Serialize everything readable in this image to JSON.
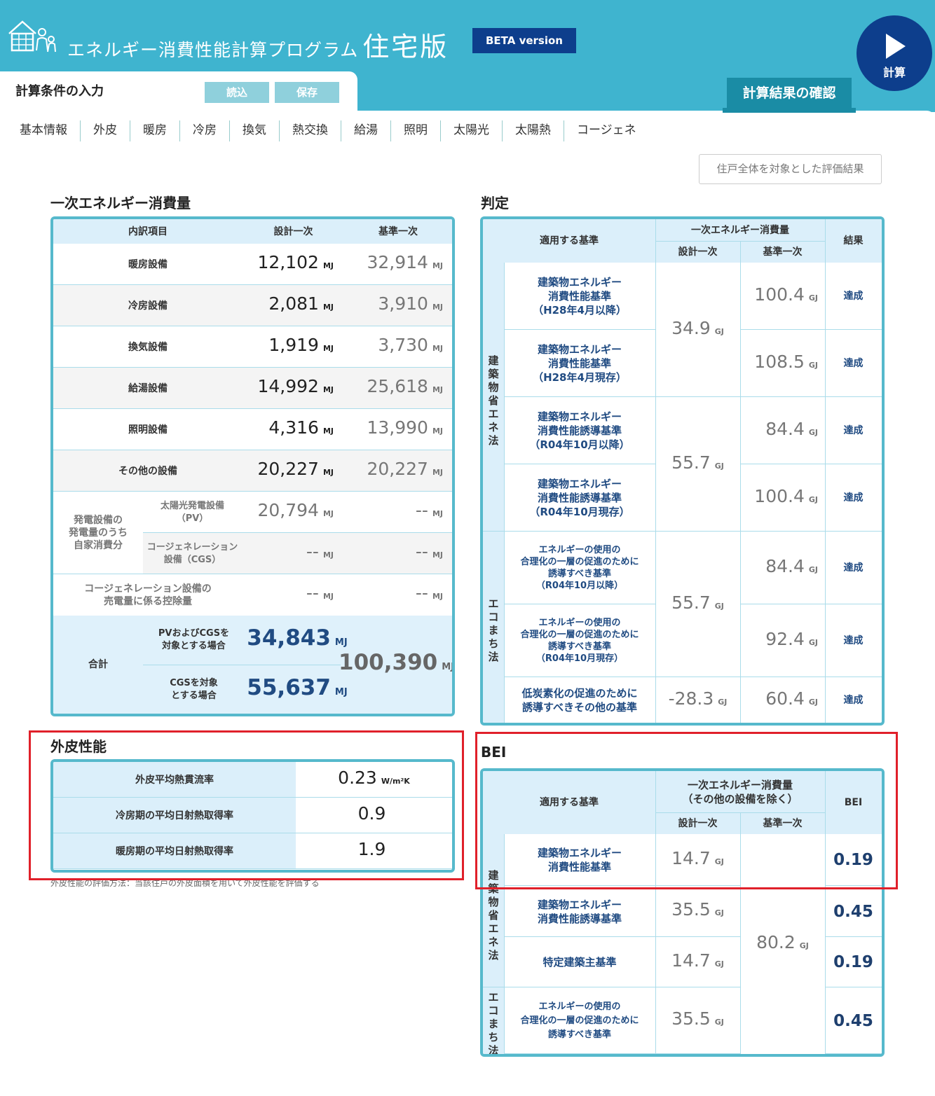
{
  "header": {
    "title": "エネルギー消費性能計算プログラム",
    "title_big": "住宅版",
    "beta": "BETA version",
    "calc_button": "計算"
  },
  "input_tab": {
    "label": "計算条件の入力",
    "load": "読込",
    "save": "保存"
  },
  "result_tab": "計算結果の確認",
  "nav": [
    "基本情報",
    "外皮",
    "暖房",
    "冷房",
    "換気",
    "熱交換",
    "給湯",
    "照明",
    "太陽光",
    "太陽熱",
    "コージェネ"
  ],
  "scope_button": "住戸全体を対象とした評価結果",
  "primary": {
    "title": "一次エネルギー消費量",
    "headers": [
      "内訳項目",
      "設計一次",
      "基準一次"
    ],
    "unit": "MJ",
    "rows": [
      {
        "label": "暖房設備",
        "design": "12,102",
        "base": "32,914"
      },
      {
        "label": "冷房設備",
        "design": "2,081",
        "base": "3,910"
      },
      {
        "label": "換気設備",
        "design": "1,919",
        "base": "3,730"
      },
      {
        "label": "給湯設備",
        "design": "14,992",
        "base": "25,618"
      },
      {
        "label": "照明設備",
        "design": "4,316",
        "base": "13,990"
      },
      {
        "label": "その他の設備",
        "design": "20,227",
        "base": "20,227"
      }
    ],
    "gen_group": "発電設備の\n発電量のうち\n自家消費分",
    "pv": {
      "label": "太陽光発電設備\n（PV）",
      "design": "20,794",
      "base": "‐‐"
    },
    "cgs": {
      "label": "コージェネレーション\n設備（CGS）",
      "design": "‐‐",
      "base": "‐‐"
    },
    "sell": {
      "label": "コージェネレーション設備の\n売電量に係る控除量",
      "design": "‐‐",
      "base": "‐‐"
    },
    "total": {
      "label": "合計",
      "pv_cgs_label": "PVおよびCGSを\n対象とする場合",
      "pv_cgs_value": "34,843",
      "cgs_label": "CGSを対象\nとする場合",
      "cgs_value": "55,637",
      "base_value": "100,390"
    }
  },
  "judge": {
    "title": "判定",
    "headers": {
      "standard": "適用する基準",
      "energy": "一次エネルギー消費量",
      "design": "設計一次",
      "base": "基準一次",
      "result": "結果"
    },
    "unit": "GJ",
    "law1": "建築物省エネ法",
    "law2": "エコまち法",
    "rows": [
      {
        "label": "建築物エネルギー\n消費性能基準\n（H28年4月以降）",
        "base": "100.4",
        "result": "達成"
      },
      {
        "label": "建築物エネルギー\n消費性能基準\n（H28年4月現存）",
        "base": "108.5",
        "result": "達成"
      },
      {
        "label": "建築物エネルギー\n消費性能誘導基準\n（R04年10月以降）",
        "base": "84.4",
        "result": "達成"
      },
      {
        "label": "建築物エネルギー\n消費性能誘導基準\n（R04年10月現存）",
        "base": "100.4",
        "result": "達成"
      },
      {
        "label": "エネルギーの使用の\n合理化の一層の促進のために\n誘導すべき基準\n（R04年10月以降）",
        "base": "84.4",
        "result": "達成"
      },
      {
        "label": "エネルギーの使用の\n合理化の一層の促進のために\n誘導すべき基準\n（R04年10月現存）",
        "base": "92.4",
        "result": "達成"
      },
      {
        "label": "低炭素化の促進のために\n誘導すべきその他の基準",
        "base": "60.4",
        "result": "達成"
      }
    ],
    "design_values": [
      "34.9",
      "55.7",
      "55.7",
      "-28.3"
    ]
  },
  "envelope": {
    "title": "外皮性能",
    "rows": [
      {
        "label": "外皮平均熱貫流率",
        "value": "0.23",
        "unit": "W/m²K"
      },
      {
        "label": "冷房期の平均日射熱取得率",
        "value": "0.9",
        "unit": ""
      },
      {
        "label": "暖房期の平均日射熱取得率",
        "value": "1.9",
        "unit": ""
      }
    ],
    "note": "外皮性能の評価方法：当該住戸の外皮面積を用いて外皮性能を評価する"
  },
  "bei": {
    "title": "BEI",
    "headers": {
      "standard": "適用する基準",
      "energy": "一次エネルギー消費量\n（その他の設備を除く）",
      "design": "設計一次",
      "base": "基準一次",
      "bei": "BEI"
    },
    "unit": "GJ",
    "law1": "建築物省エネ法",
    "law2": "エコまち法",
    "rows": [
      {
        "label": "建築物エネルギー\n消費性能基準",
        "design": "14.7",
        "bei": "0.19"
      },
      {
        "label": "建築物エネルギー\n消費性能誘導基準",
        "design": "35.5",
        "bei": "0.45"
      },
      {
        "label": "特定建築主基準",
        "design": "14.7",
        "bei": "0.19"
      },
      {
        "label": "エネルギーの使用の\n合理化の一層の促進のために\n誘導すべき基準",
        "design": "35.5",
        "bei": "0.45"
      }
    ],
    "base": "80.2"
  },
  "colors": {
    "header_bg": "#3fb4cf",
    "navy": "#0d3e8c",
    "table_border": "#56b9cc",
    "highlight": "#e0202a"
  }
}
